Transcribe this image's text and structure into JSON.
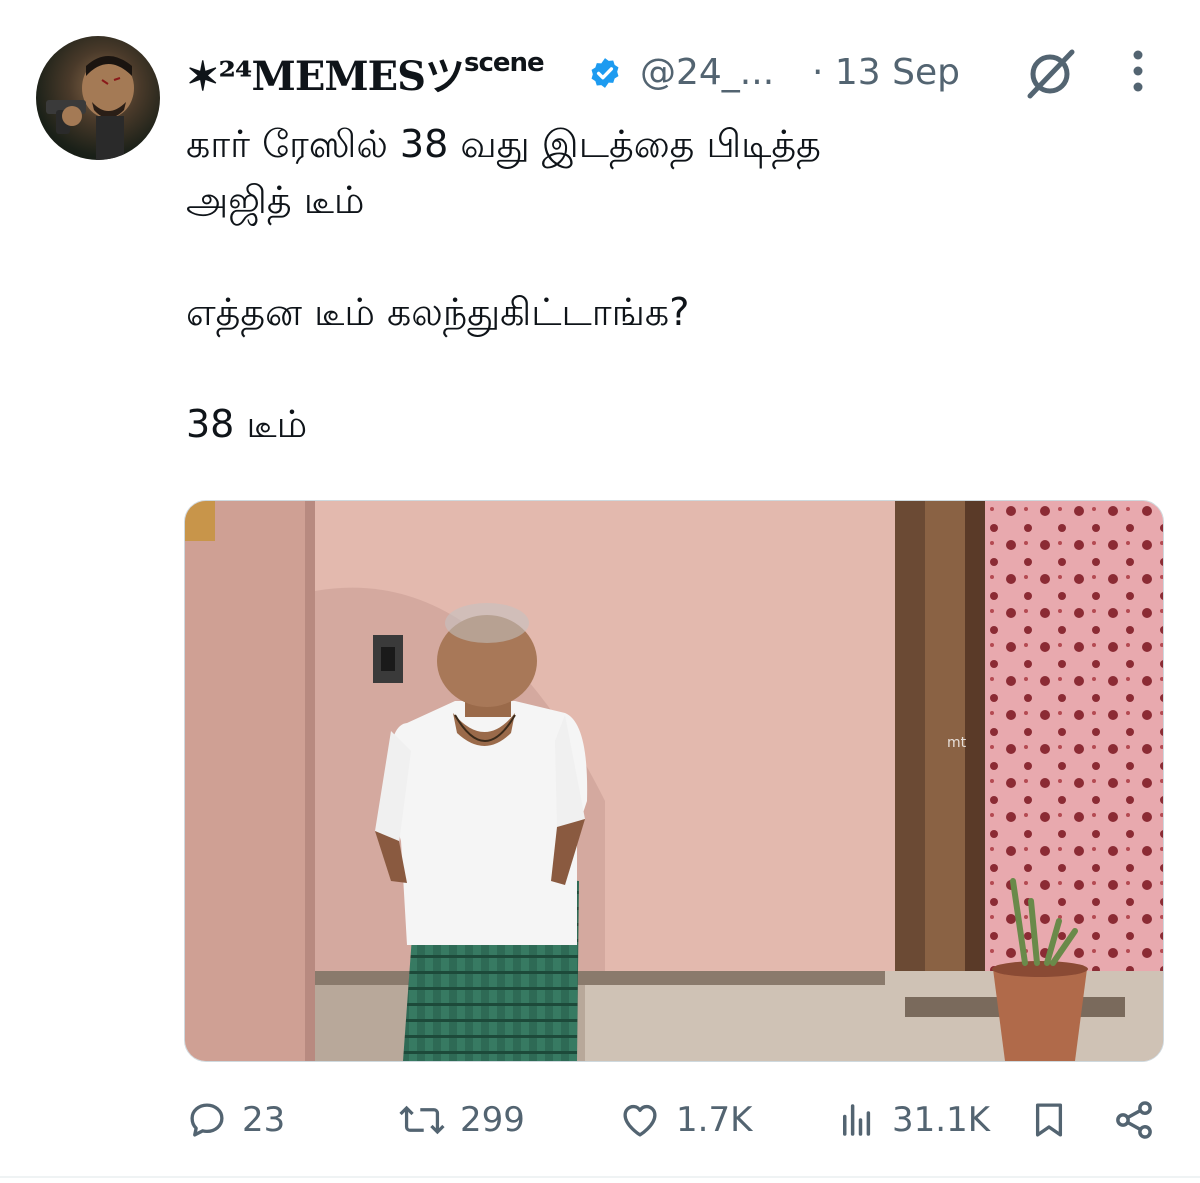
{
  "tweet": {
    "display_name": "✶²⁴MEMESツ",
    "display_name_suffix": "scene",
    "handle": "@24_...",
    "date": "· 13 Sep",
    "text": "கார் ரேஸில் 38 வது இடத்தை பிடித்த\nஅஜித் டீம்\n\nஎத்தன டீம் கலந்துகிட்டாங்க?\n\n38 டீம்",
    "media_watermark": "mt"
  },
  "actions": {
    "replies": "23",
    "reposts": "299",
    "likes": "1.7K",
    "views": "31.1K"
  },
  "colors": {
    "verified_blue": "#1d9bf0",
    "muted_gray": "#536471"
  },
  "icons": [
    "verified-badge-icon",
    "grok-icon",
    "more-icon",
    "reply-icon",
    "repost-icon",
    "like-icon",
    "views-icon",
    "bookmark-icon",
    "share-icon"
  ]
}
